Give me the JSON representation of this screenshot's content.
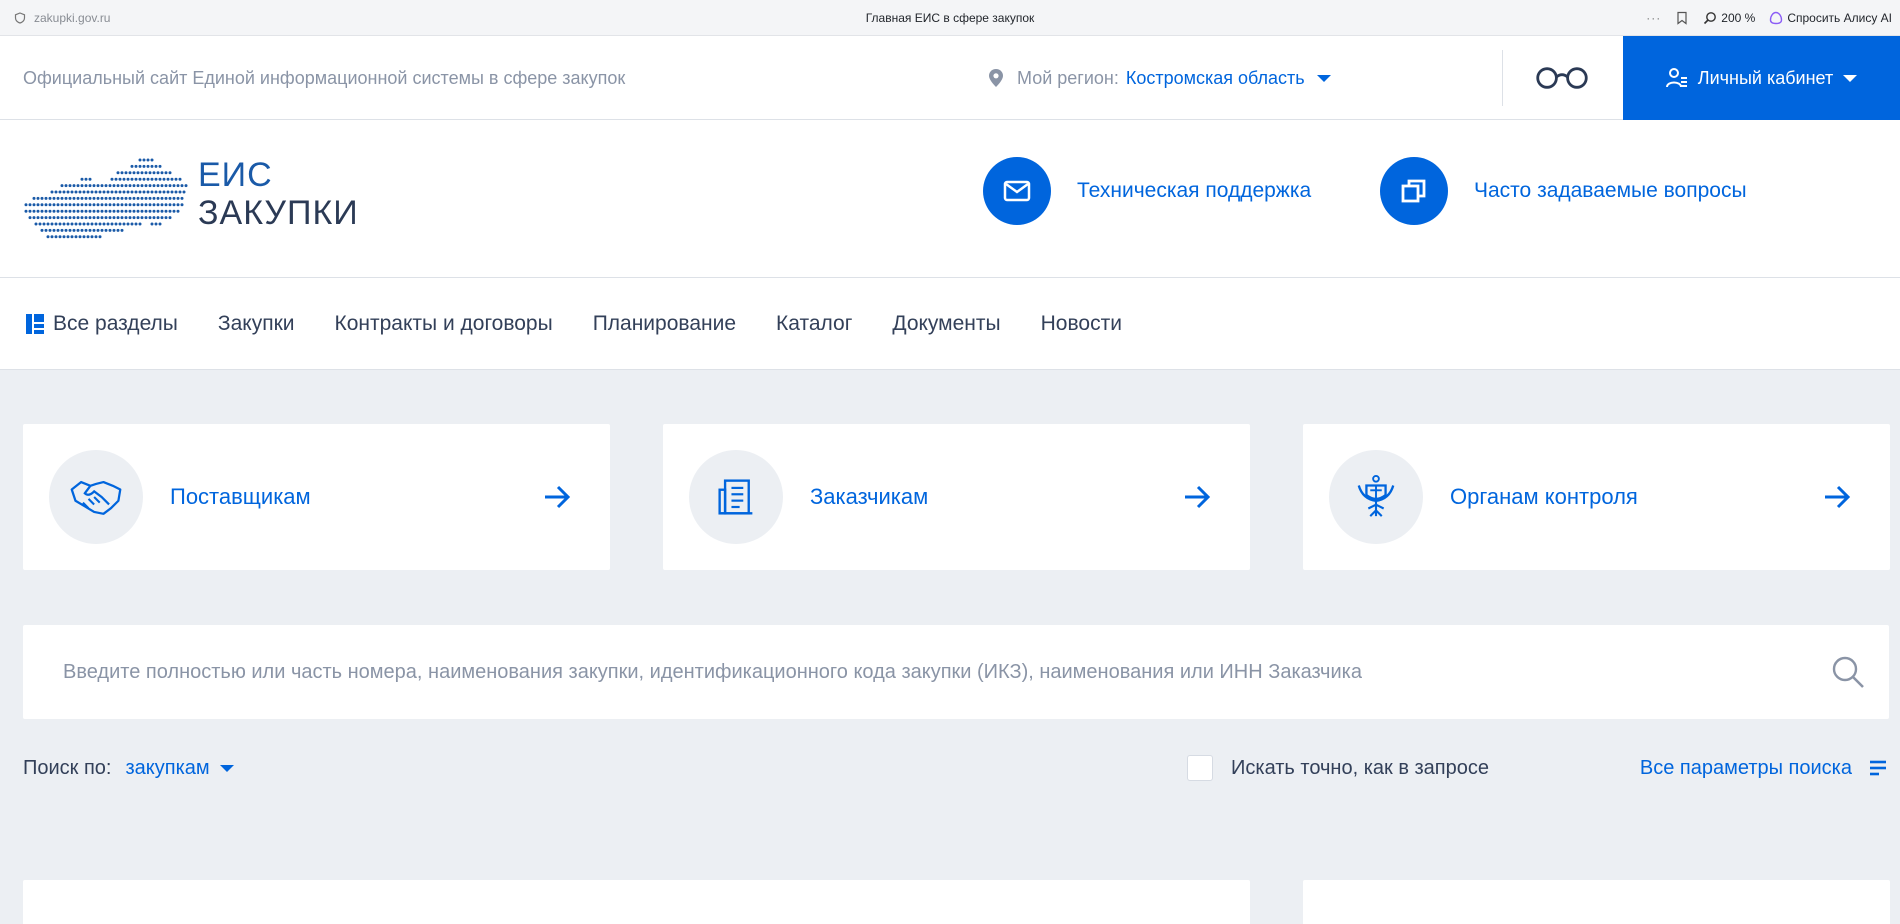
{
  "browser": {
    "url": "zakupki.gov.ru",
    "title": "Главная ЕИС в сфере закупок",
    "dots": "···",
    "zoom": "200 %",
    "alice": "Спросить Алису AI"
  },
  "topbar": {
    "site_description": "Официальный сайт Единой информационной системы в сфере закупок",
    "region_label": "Мой регион:",
    "region_value": "Костромская область",
    "cabinet_label": "Личный кабинет"
  },
  "header": {
    "logo_line1": "ЕИС",
    "logo_line2": "ЗАКУПКИ",
    "support_label": "Техническая поддержка",
    "faq_label": "Часто задаваемые вопросы"
  },
  "nav": {
    "items": [
      {
        "label": "Все разделы",
        "icon": "sections-icon"
      },
      {
        "label": "Закупки"
      },
      {
        "label": "Контракты и договоры"
      },
      {
        "label": "Планирование"
      },
      {
        "label": "Каталог"
      },
      {
        "label": "Документы"
      },
      {
        "label": "Новости"
      }
    ]
  },
  "roles": [
    {
      "label": "Поставщикам",
      "icon": "handshake-icon"
    },
    {
      "label": "Заказчикам",
      "icon": "document-icon"
    },
    {
      "label": "Органам контроля",
      "icon": "emblem-icon"
    }
  ],
  "search": {
    "placeholder": "Введите полностью или часть номера, наименования закупки, идентификационного кода закупки (ИКЗ), наименования или ИНН Заказчика",
    "by_label": "Поиск по:",
    "by_value": "закупкам",
    "exact_label": "Искать точно, как в запросе",
    "exact_checked": false,
    "all_params_label": "Все параметры поиска"
  },
  "colors": {
    "accent": "#0065dd",
    "background": "#eceff3",
    "muted_text": "#8a94a6",
    "text": "#334059"
  }
}
